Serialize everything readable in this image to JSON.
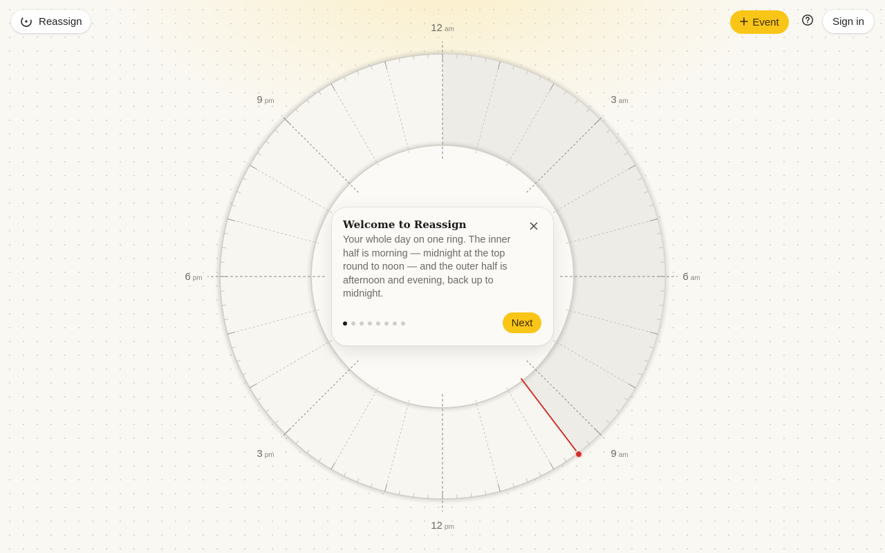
{
  "app": {
    "name": "Reassign"
  },
  "header": {
    "event_label": "Event",
    "sign_in_label": "Sign in",
    "icons": {
      "logo": "reassign-logo-icon",
      "plus": "plus-icon",
      "help": "help-circle-icon"
    }
  },
  "clock": {
    "hour_labels": [
      {
        "id": "12am",
        "num": "12",
        "suffix": "am"
      },
      {
        "id": "3am",
        "num": "3",
        "suffix": "am"
      },
      {
        "id": "6am",
        "num": "6",
        "suffix": "am"
      },
      {
        "id": "9am",
        "num": "9",
        "suffix": "am"
      },
      {
        "id": "12pm",
        "num": "12",
        "suffix": "pm"
      },
      {
        "id": "3pm",
        "num": "3",
        "suffix": "pm"
      },
      {
        "id": "6pm",
        "num": "6",
        "suffix": "pm"
      },
      {
        "id": "9pm",
        "num": "9",
        "suffix": "pm"
      }
    ],
    "current_time_color": "#d2312b"
  },
  "tour": {
    "title": "Welcome to Reassign",
    "body": "Your whole day on one ring. The inner half is morning — midnight at the top round to noon — and the outer half is afternoon and evening, back up to midnight.",
    "next_label": "Next",
    "step_current": 1,
    "step_total": 8
  },
  "colors": {
    "accent": "#f9c516",
    "background": "#faf8f3"
  }
}
